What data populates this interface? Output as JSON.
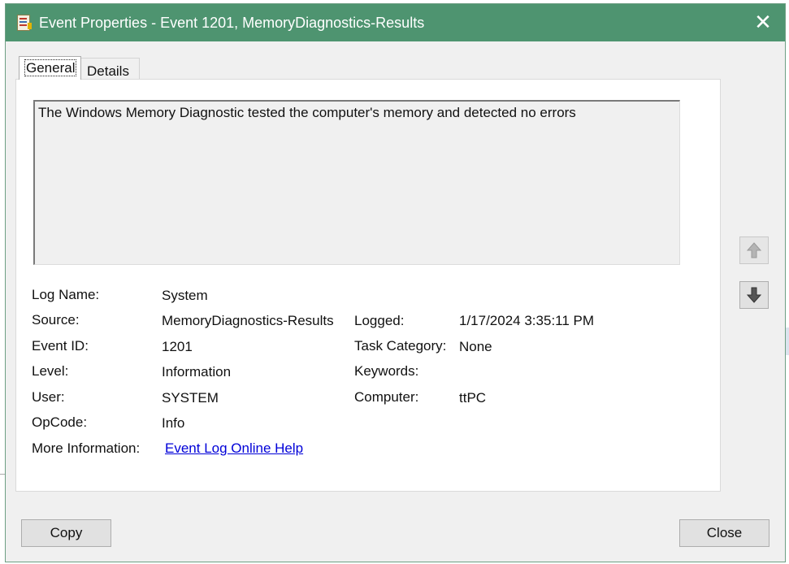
{
  "window": {
    "title": "Event Properties - Event 1201, MemoryDiagnostics-Results",
    "close_icon": "close-icon"
  },
  "tabs": [
    {
      "label": "General",
      "selected": true
    },
    {
      "label": "Details",
      "selected": false
    }
  ],
  "description": "The Windows Memory Diagnostic tested the computer's memory and detected no errors",
  "fields": {
    "log_name": {
      "label": "Log Name:",
      "value": "System"
    },
    "source": {
      "label": "Source:",
      "value": "MemoryDiagnostics-Results"
    },
    "event_id": {
      "label": "Event ID:",
      "value": "1201"
    },
    "level": {
      "label": "Level:",
      "value": "Information"
    },
    "user": {
      "label": "User:",
      "value": "SYSTEM"
    },
    "opcode": {
      "label": "OpCode:",
      "value": "Info"
    },
    "more_info": {
      "label": "More Information:",
      "link": "Event Log Online Help"
    },
    "logged": {
      "label": "Logged:",
      "value": "1/17/2024 3:35:11 PM"
    },
    "task_category": {
      "label": "Task Category:",
      "value": "None"
    },
    "keywords": {
      "label": "Keywords:",
      "value": ""
    },
    "computer": {
      "label": "Computer:",
      "value": "ttPC"
    }
  },
  "buttons": {
    "copy": "Copy",
    "close": "Close",
    "up_icon": "arrow-up-icon",
    "down_icon": "arrow-down-icon"
  },
  "colors": {
    "titlebar": "#4e9470",
    "link": "#0000d8"
  }
}
